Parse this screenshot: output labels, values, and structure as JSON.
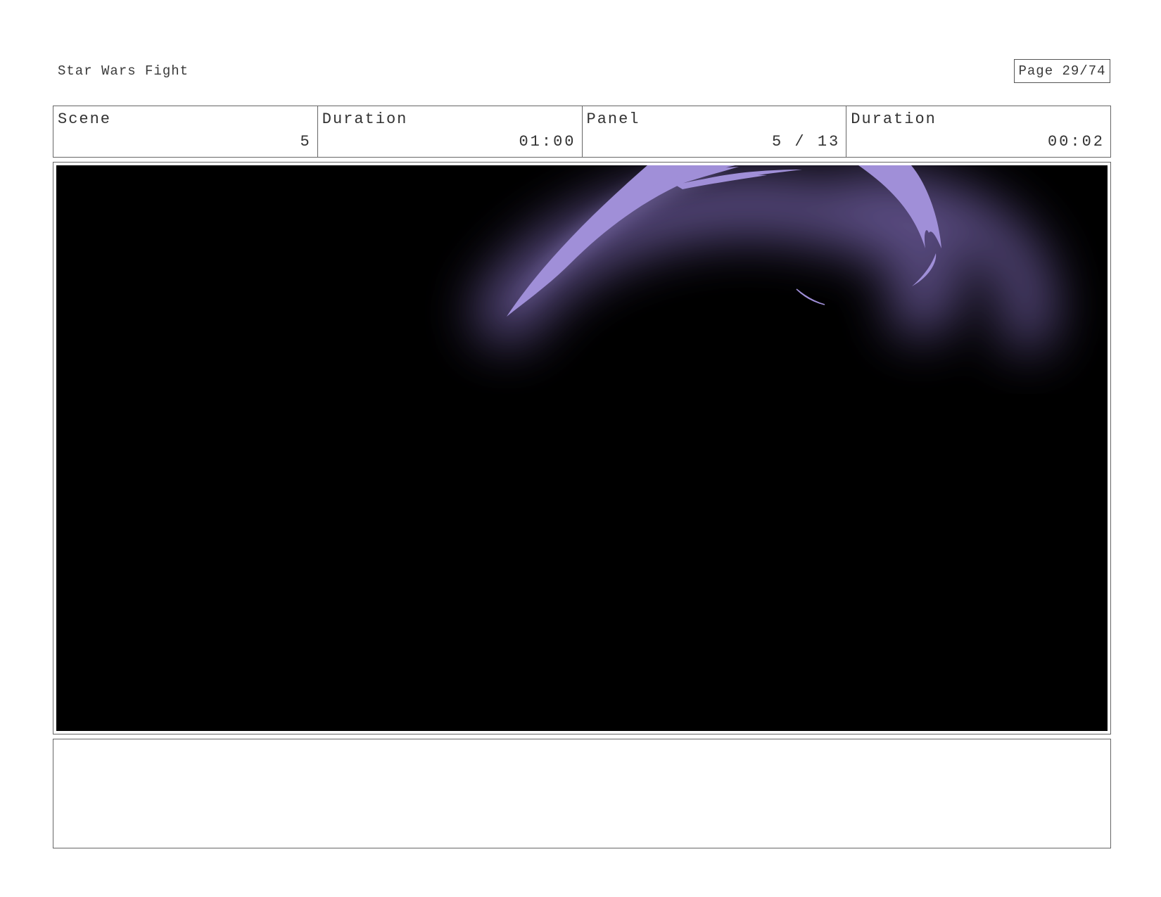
{
  "header": {
    "project_title": "Star Wars Fight",
    "page_label": "Page 29/74"
  },
  "meta": {
    "scene_label": "Scene",
    "scene_value": "5",
    "scene_duration_label": "Duration",
    "scene_duration_value": "01:00",
    "panel_label": "Panel",
    "panel_value": "5 / 13",
    "panel_duration_label": "Duration",
    "panel_duration_value": "00:02"
  },
  "panel": {
    "background_color": "#000000",
    "saber_color": "#a08fd8",
    "glow_color": "#6b5a9a"
  },
  "notes": {
    "text": ""
  }
}
